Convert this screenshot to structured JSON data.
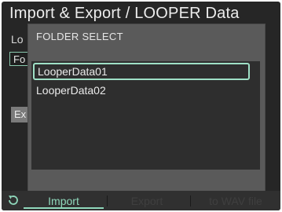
{
  "screen": {
    "title": "Import & Export / LOOPER Data",
    "background_label": "Lo",
    "background_field": "Fo",
    "background_exec": "Ex"
  },
  "dialog": {
    "title": "FOLDER SELECT",
    "items": [
      {
        "label": "LooperData01",
        "selected": true
      },
      {
        "label": "LooperData02",
        "selected": false
      }
    ]
  },
  "footer": {
    "back_icon": "undo-arrow-icon",
    "tabs": [
      {
        "label": "Import",
        "active": true
      },
      {
        "label": "Export",
        "active": false
      },
      {
        "label": "to WAV file",
        "active": false
      }
    ]
  },
  "colors": {
    "accent": "#8fd8bb",
    "screen_bg": "#262626",
    "dialog_bg": "#5a5a5a",
    "list_bg": "#2e2e2e"
  }
}
